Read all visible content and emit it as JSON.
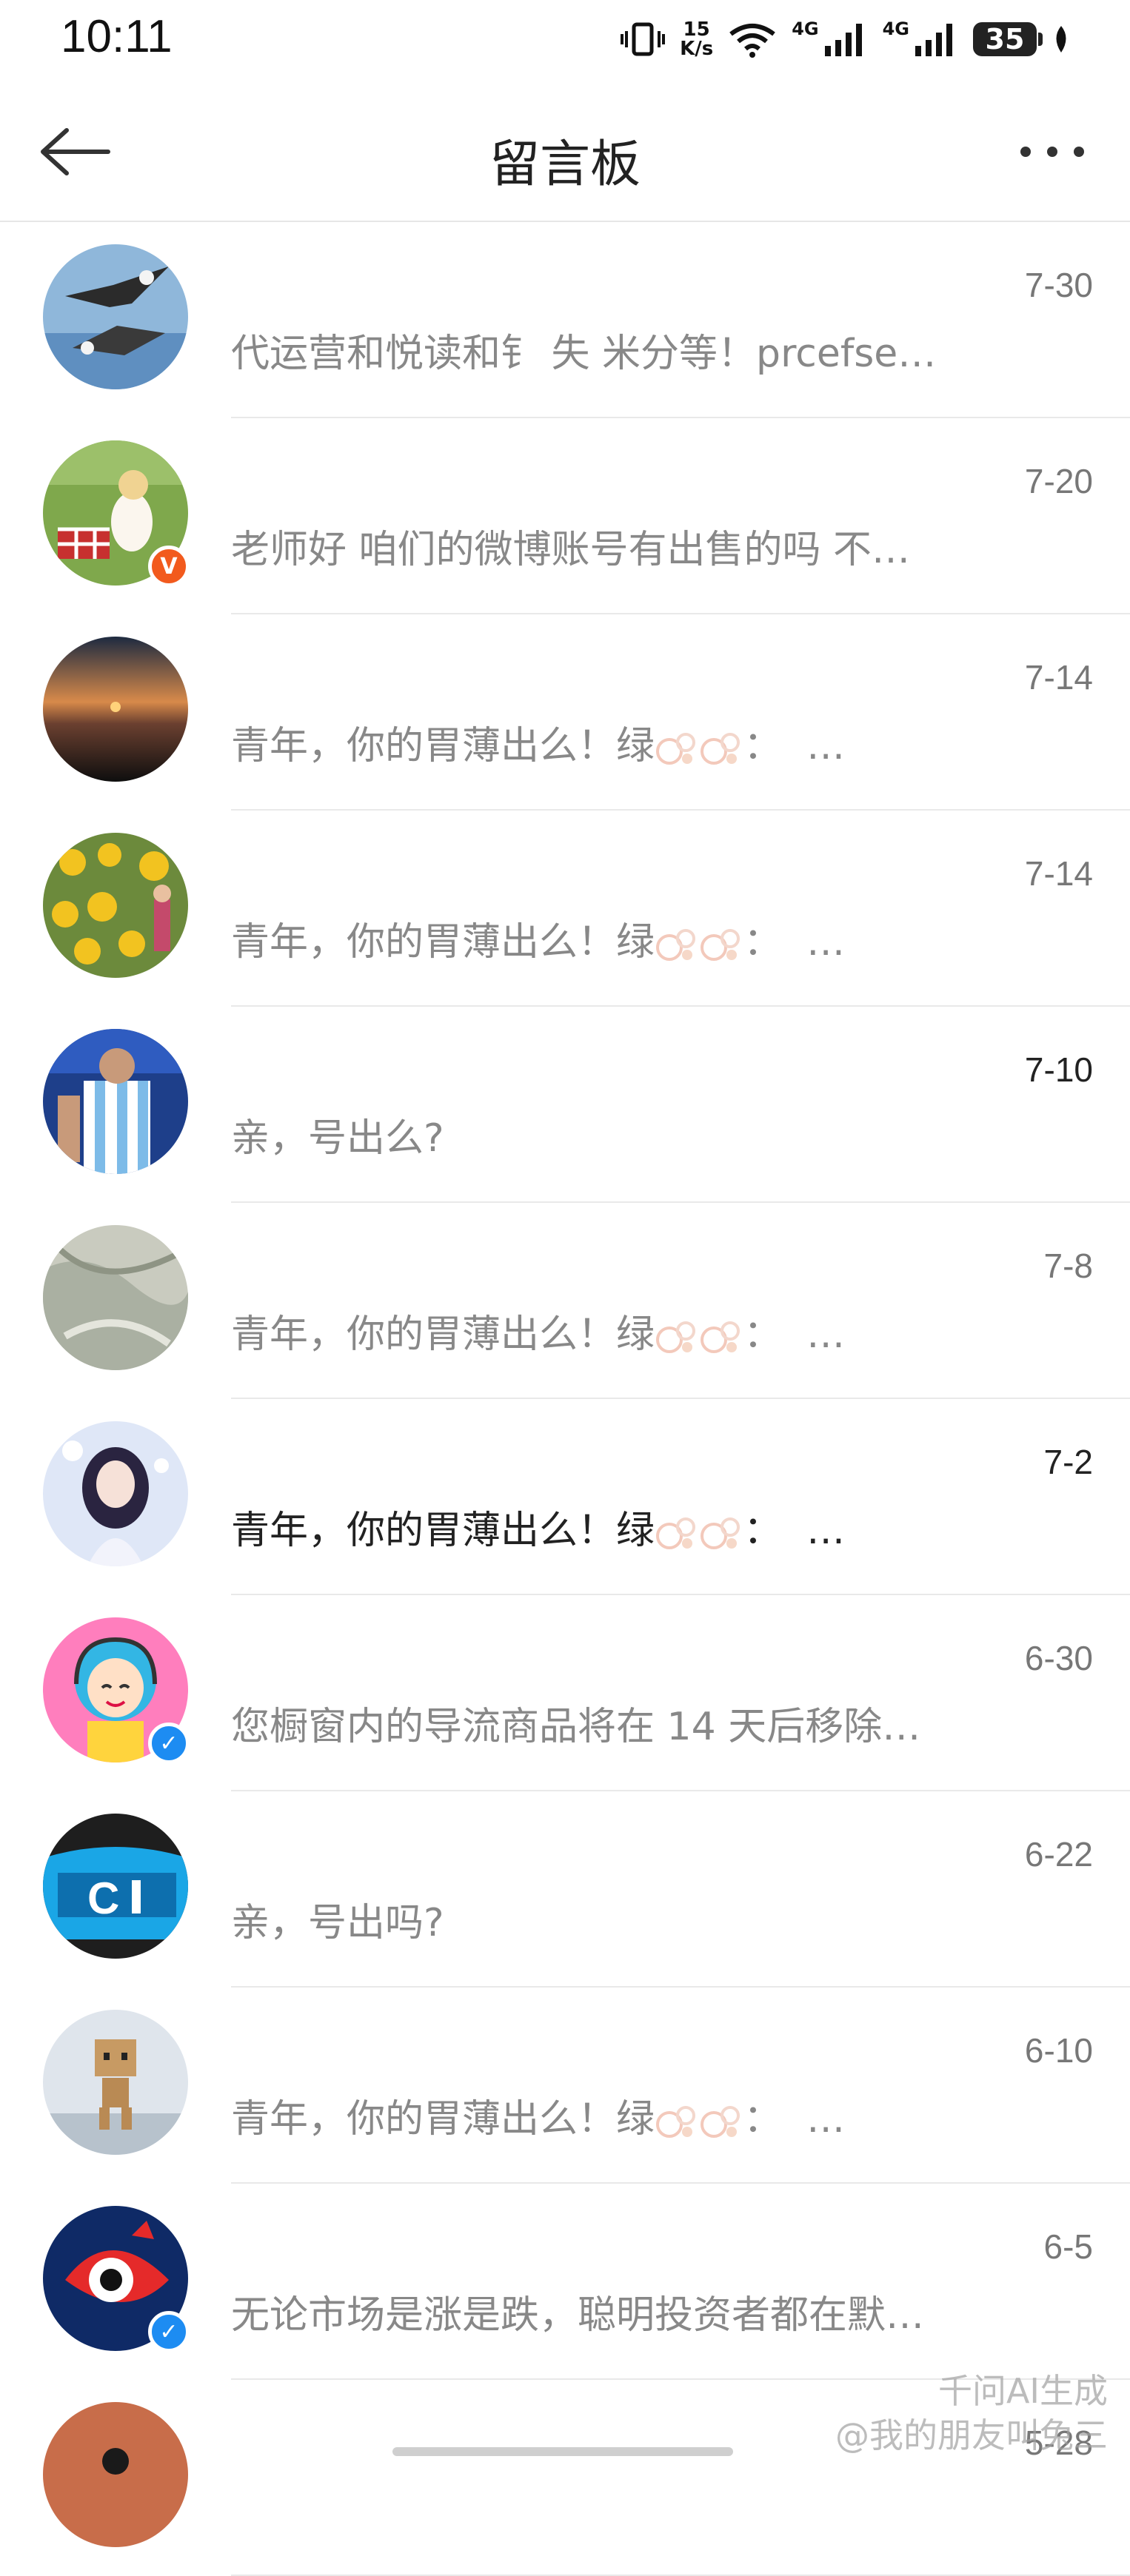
{
  "status_bar": {
    "time": "10:11",
    "net_speed_value": "15",
    "net_speed_unit": "K/s",
    "signal_1_label": "4G",
    "signal_2_label": "4G",
    "battery": "35"
  },
  "nav": {
    "title": "留言板"
  },
  "messages": [
    {
      "date": "7-30",
      "text": "代运营和悦读和钅 失 米分等！prcefse…",
      "avatar": "eagles-icon",
      "badge": "",
      "highlight": false
    },
    {
      "date": "7-20",
      "text": "老师好 咱们的微博账号有出售的吗 不…",
      "avatar": "girl-picnic-icon",
      "badge": "orange",
      "highlight": false
    },
    {
      "date": "7-14",
      "text": "青年，你的胃薄出么！绿",
      "text_tail": "：  …",
      "avatar": "sunset-icon",
      "badge": "",
      "highlight": false
    },
    {
      "date": "7-14",
      "text": "青年，你的胃薄出么！绿",
      "text_tail": "：  …",
      "avatar": "flowers-icon",
      "badge": "",
      "highlight": false
    },
    {
      "date": "7-10",
      "text": "亲，号出么?",
      "avatar": "footballer-icon",
      "badge": "",
      "highlight": "date"
    },
    {
      "date": "7-8",
      "text": "青年，你的胃薄出么！绿",
      "text_tail": "：  …",
      "avatar": "fabric-icon",
      "badge": "",
      "highlight": false
    },
    {
      "date": "7-2",
      "text": "青年，你的胃薄出么！绿",
      "text_tail": "：  …",
      "avatar": "anime-girl-icon",
      "badge": "",
      "highlight": "both"
    },
    {
      "date": "6-30",
      "text": "您橱窗内的导流商品将在 14 天后移除…",
      "avatar": "service-girl-icon",
      "badge": "blue",
      "highlight": false
    },
    {
      "date": "6-22",
      "text": "亲，号出吗?",
      "avatar": "blue-car-icon",
      "badge": "",
      "highlight": false
    },
    {
      "date": "6-10",
      "text": "青年，你的胃薄出么！绿",
      "text_tail": "：  …",
      "avatar": "danbo-robot-icon",
      "badge": "",
      "highlight": false
    },
    {
      "date": "6-5",
      "text": "无论市场是涨是跌，聪明投资者都在默…",
      "avatar": "weibo-eye-icon",
      "badge": "blue",
      "highlight": false
    },
    {
      "date": "5-28",
      "text": "",
      "avatar": "sunset-red-icon",
      "badge": "",
      "highlight": false
    }
  ],
  "watermark": {
    "line1": "千问AI生成",
    "line2": "@我的朋友叫兔三"
  },
  "colors": {
    "badge_orange": "#f25a1d",
    "badge_blue": "#1d8cf2",
    "text_muted": "#888888",
    "text_dark": "#222222"
  }
}
